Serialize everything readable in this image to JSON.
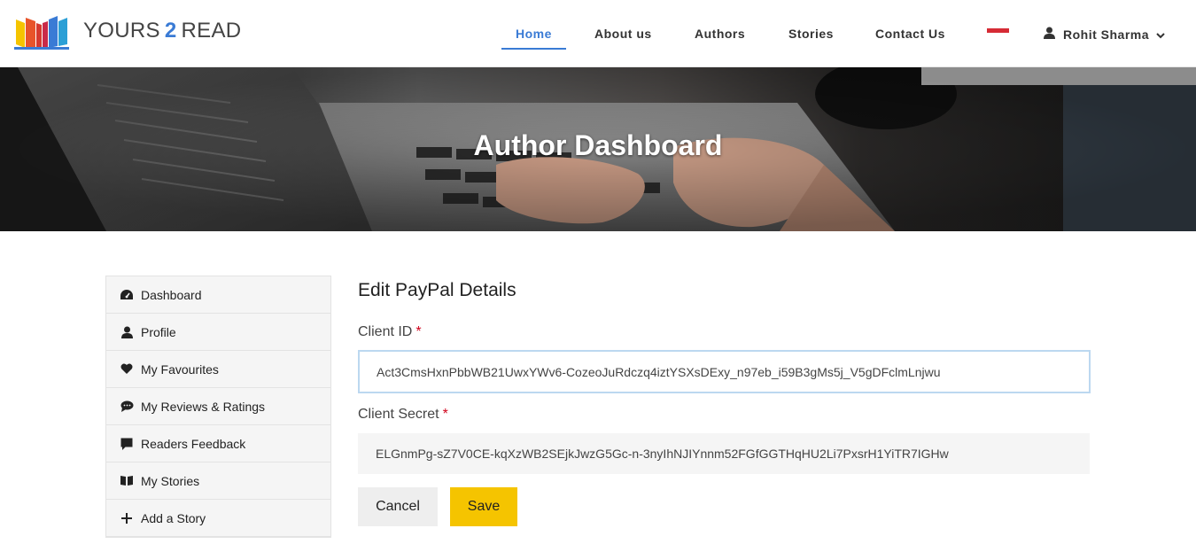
{
  "brand": {
    "name_part1": "YOURS",
    "name_part2": "2",
    "name_part3": "READ"
  },
  "nav": {
    "items": [
      {
        "label": "Home",
        "active": true
      },
      {
        "label": "About us"
      },
      {
        "label": "Authors"
      },
      {
        "label": "Stories"
      },
      {
        "label": "Contact Us"
      }
    ],
    "user": {
      "name": "Rohit Sharma"
    },
    "language_flag": "flag-icon"
  },
  "hero": {
    "title": "Author Dashboard"
  },
  "sidebar": {
    "items": [
      {
        "label": "Dashboard",
        "icon": "dashboard-icon"
      },
      {
        "label": "Profile",
        "icon": "user-icon"
      },
      {
        "label": "My Favourites",
        "icon": "heart-icon"
      },
      {
        "label": "My Reviews & Ratings",
        "icon": "comment-icon"
      },
      {
        "label": "Readers Feedback",
        "icon": "message-icon"
      },
      {
        "label": "My Stories",
        "icon": "book-icon"
      },
      {
        "label": "Add a Story",
        "icon": "plus-icon"
      }
    ]
  },
  "form": {
    "title": "Edit PayPal Details",
    "client_id": {
      "label": "Client ID",
      "required": "*",
      "value": "Act3CmsHxnPbbWB21UwxYWv6-CozeoJuRdczq4iztYSXsDExy_n97eb_i59B3gMs5j_V5gDFclmLnjwu"
    },
    "client_secret": {
      "label": "Client Secret",
      "required": "*",
      "value": "ELGnmPg-sZ7V0CE-kqXzWB2SEjkJwzG5Gc-n-3nyIhNJIYnnm52FGfGGTHqHU2Li7PxsrH1YiTR7IGHw"
    },
    "cancel_label": "Cancel",
    "save_label": "Save"
  },
  "colors": {
    "accent": "#3a7bd5",
    "save": "#f5c400",
    "required": "#d0021b"
  }
}
